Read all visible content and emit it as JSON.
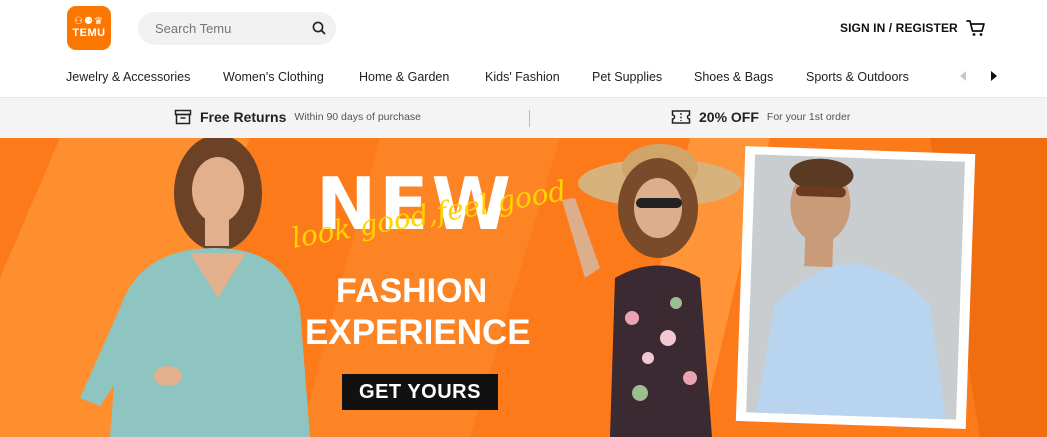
{
  "header": {
    "logo": {
      "glyphs": "⚇⚈♛",
      "word": "TEMU"
    },
    "search": {
      "placeholder": "Search Temu",
      "value": ""
    },
    "signin_label": "SIGN IN / REGISTER"
  },
  "nav": {
    "categories": [
      "Jewelry & Accessories",
      "Women's Clothing",
      "Home & Garden",
      "Kids' Fashion",
      "Pet Supplies",
      "Shoes & Bags",
      "Sports & Outdoors"
    ]
  },
  "promo": {
    "returns": {
      "title": "Free Returns",
      "subtitle": "Within 90 days of purchase"
    },
    "discount": {
      "title": "20% OFF",
      "subtitle": "For your 1st order"
    }
  },
  "banner": {
    "headline": "NEW",
    "script": "look good,feel good",
    "line1": "FASHION",
    "line2": "EXPERIENCE",
    "cta": "GET YOURS"
  },
  "colors": {
    "brand": "#fb7701",
    "banner_bg": "#fc7a1a",
    "script": "#ffd400"
  }
}
